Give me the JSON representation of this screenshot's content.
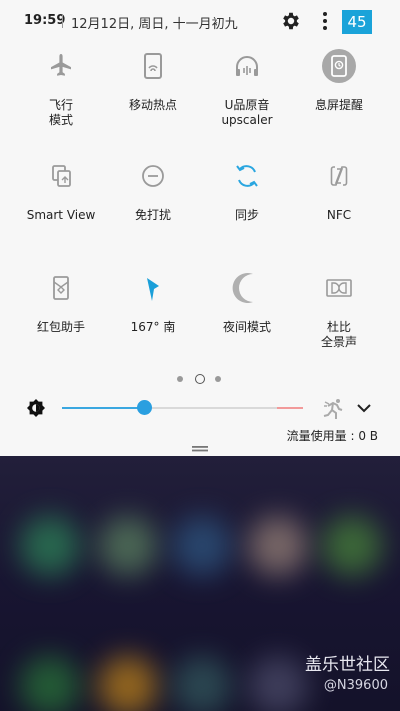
{
  "status": {
    "time": "19:59",
    "date": "12月12日, 周日, 十一月初九",
    "badge": "45"
  },
  "tiles": [
    {
      "label": "飞行\n模式",
      "icon": "airplane-icon"
    },
    {
      "label": "移动热点",
      "icon": "hotspot-icon"
    },
    {
      "label": "U品原音\nupscaler",
      "icon": "upscaler-icon"
    },
    {
      "label": "息屏提醒",
      "icon": "always-on-display-icon"
    },
    {
      "label": "Smart View",
      "icon": "smart-view-icon"
    },
    {
      "label": "免打扰",
      "icon": "do-not-disturb-icon"
    },
    {
      "label": "同步",
      "icon": "sync-icon"
    },
    {
      "label": "NFC",
      "icon": "nfc-icon"
    },
    {
      "label": "红包助手",
      "icon": "red-envelope-icon"
    },
    {
      "label": "167° 南",
      "icon": "compass-icon"
    },
    {
      "label": "夜间模式",
      "icon": "night-mode-icon"
    },
    {
      "label": "杜比\n全景声",
      "icon": "dolby-icon"
    }
  ],
  "pagination": {
    "pages": 3,
    "current": 2
  },
  "brightness": {
    "level": 0.34,
    "auto_icon": "auto-brightness-icon"
  },
  "data_usage": "流量使用量 : 0 B",
  "watermark": {
    "brand": "盖乐世社区",
    "user": "@N39600"
  },
  "colors": {
    "accent": "#1aa3d9",
    "panel": "#f7f7f7"
  }
}
